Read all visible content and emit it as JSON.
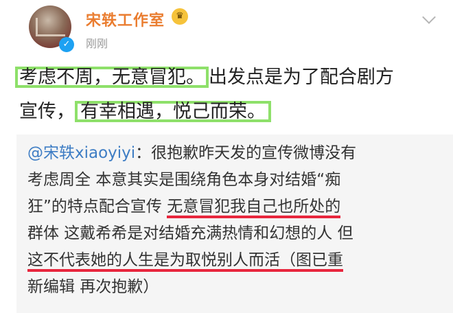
{
  "account": {
    "name": "宋轶工作室",
    "badge_emoji": "👑",
    "time": "刚刚",
    "verified_icon": "v-badge-icon",
    "menu_icon": "chevron-down-icon"
  },
  "post": {
    "line1_hl": "考虑不周，无意冒犯。",
    "line1_rest": "出发点是为了配合剧方",
    "line2_pre": "宣传，",
    "line2_hl": "有幸相遇，悦己而荣。"
  },
  "quote": {
    "mention": "@宋轶xiaoyiyi",
    "line1_rest": "：很抱歉昨天发的宣传微博没有",
    "line2": "考虑周全 本意其实是围绕角色本身对结婚“痴",
    "line3_pre": "狂”的特点配合宣传 ",
    "line3_ul": "无意冒犯我自己也所处的",
    "line4": "群体 这戴希希是对结婚充满热情和幻想的人 但",
    "line5_ul": "这不代表她的人生是为取悦别人而活（图已重",
    "line6": "新编辑 再次抱歉）"
  },
  "colors": {
    "username": "#ea7d30",
    "highlight_box": "#8ee06a",
    "underline": "#e8263d",
    "mention": "#3e7dc4"
  }
}
